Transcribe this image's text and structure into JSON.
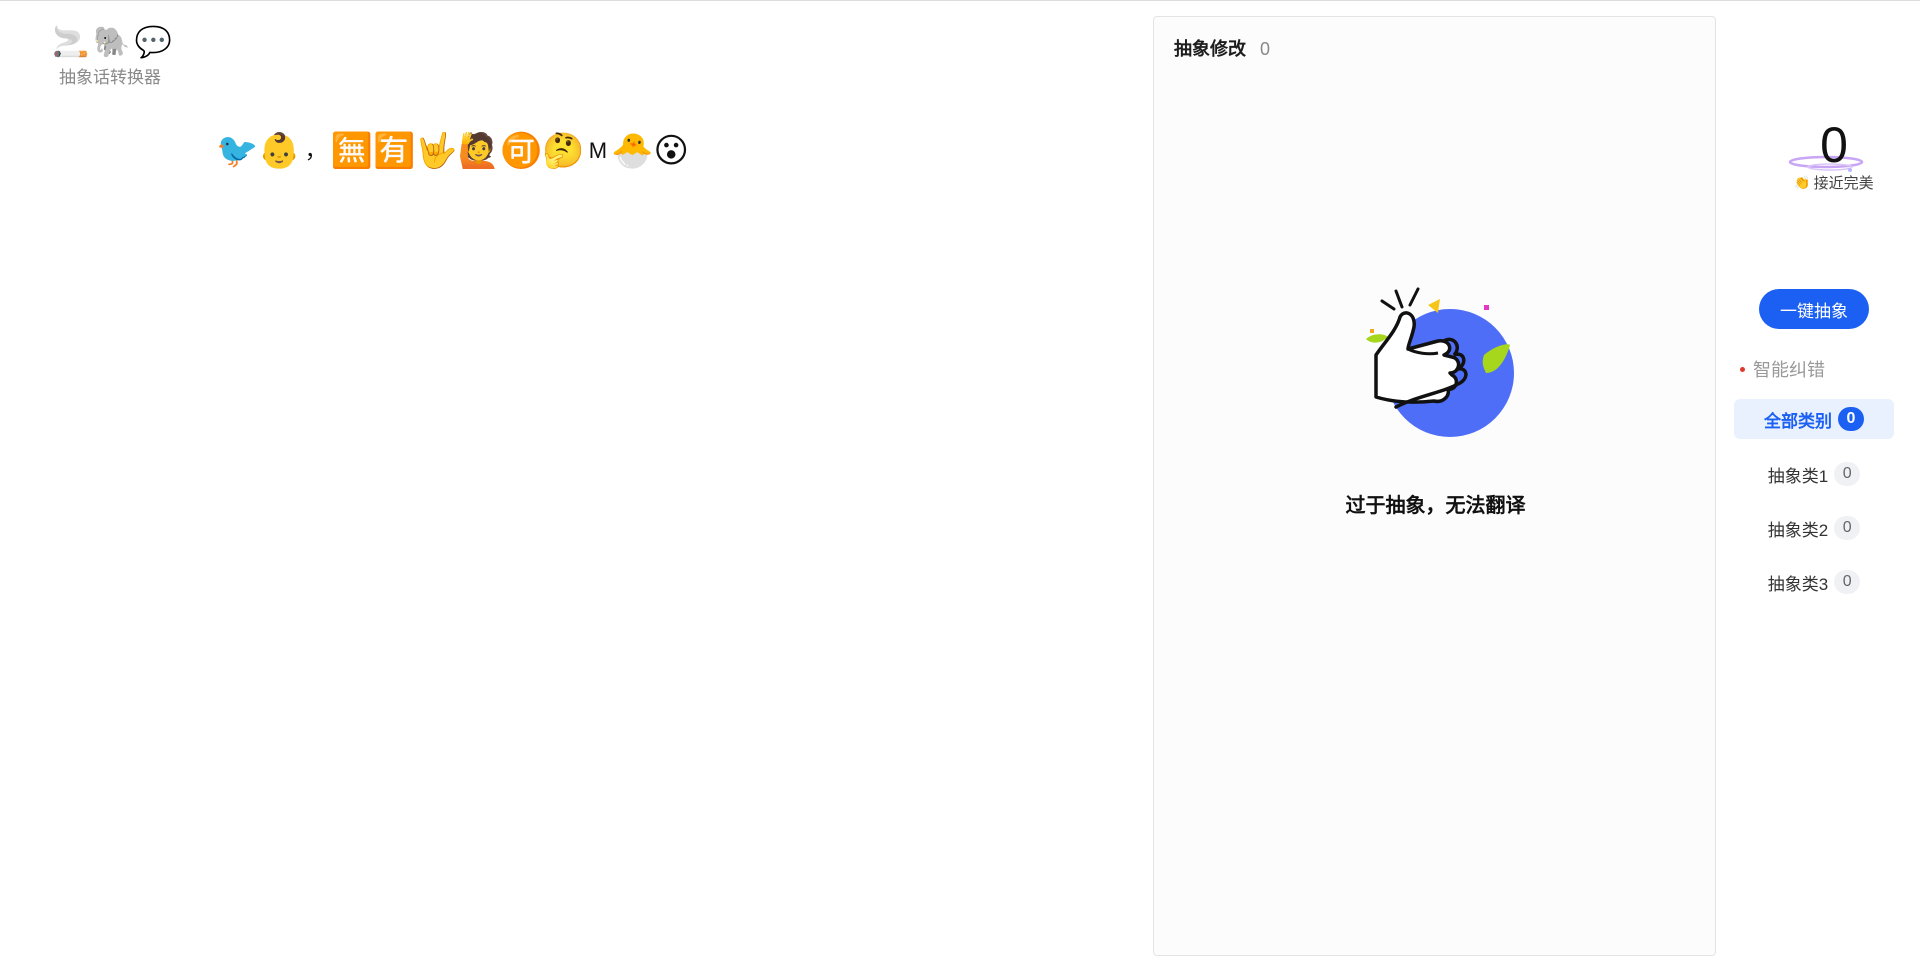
{
  "logo": {
    "icons": [
      "🚬",
      "🐘",
      "💬"
    ],
    "title": "抽象话转换器"
  },
  "editor": {
    "content": [
      "🐦",
      "👶",
      "，",
      "🈚",
      "🈶",
      "🤟",
      "🙋",
      "🉑",
      "🤔",
      "M",
      "🐣",
      "😮"
    ]
  },
  "panel": {
    "title": "抽象修改",
    "count": "0",
    "empty_text": "过于抽象，无法翻译"
  },
  "sidebar": {
    "score": "0",
    "score_label": "接近完美",
    "score_icon": "👏",
    "primary_button": "一键抽象",
    "ai_correct": "智能纠错",
    "categories": [
      {
        "label": "全部类别",
        "count": "0",
        "active": true
      },
      {
        "label": "抽象类1",
        "count": "0",
        "active": false
      },
      {
        "label": "抽象类2",
        "count": "0",
        "active": false
      },
      {
        "label": "抽象类3",
        "count": "0",
        "active": false
      }
    ]
  },
  "colors": {
    "accent": "#1b60f2",
    "dot": "#e03a2f",
    "illustration_blue": "#4f6ef7",
    "leaf_green": "#a6d71c"
  }
}
